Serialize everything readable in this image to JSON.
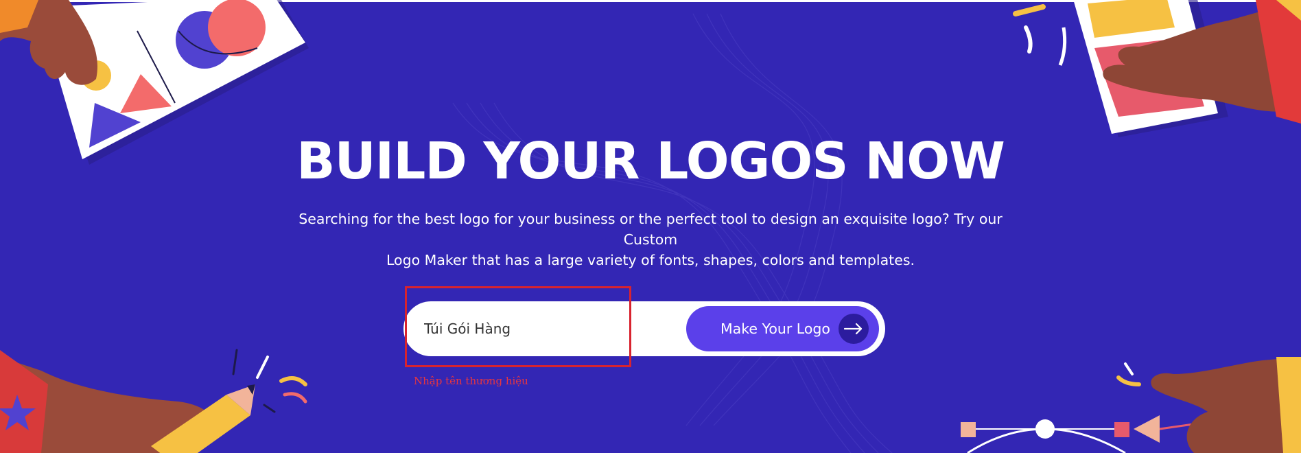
{
  "hero": {
    "headline": "BUILD YOUR LOGOS NOW",
    "subtitle_line1": "Searching for the best logo for your business or the perfect tool to design an exquisite logo? Try our Custom",
    "subtitle_line2": "Logo Maker that has a large variety of fonts, shapes, colors and templates."
  },
  "form": {
    "brand_input_value": "Túi Gói Hàng",
    "submit_label": "Make Your Logo",
    "hint": "Nhập tên thương hiệu"
  },
  "icons": {
    "submit_arrow": "arrow-right-icon"
  },
  "colors": {
    "background": "#3326b4",
    "button": "#5b40ea",
    "arrow_circle": "#2c1c9e",
    "annotation": "#d8232f"
  }
}
